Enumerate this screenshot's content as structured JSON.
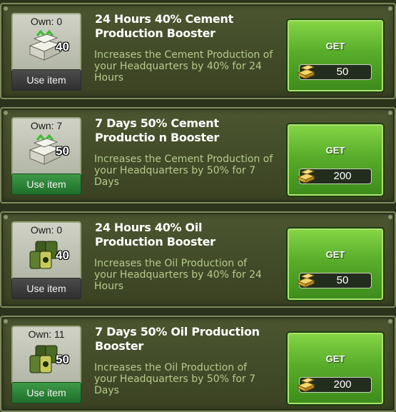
{
  "items": [
    {
      "own": "Own: 0",
      "percent": "40",
      "type": "cement",
      "use_label": "Use item",
      "use_style": "dark",
      "title": "24 Hours 40% Cement Production Booster",
      "description": "Increases the Cement Production of your Headquarters by 40% for 24 Hours",
      "get_label": "GET",
      "price": "50"
    },
    {
      "own": "Own: 7",
      "percent": "50",
      "type": "cement",
      "use_label": "Use item",
      "use_style": "green",
      "title": "7 Days 50% Cement Productio n Booster",
      "description": "Increases the Cement Production of your Headquarters by 50% for 7 Days",
      "get_label": "GET",
      "price": "200"
    },
    {
      "own": "Own: 0",
      "percent": "40",
      "type": "oil",
      "use_label": "Use item",
      "use_style": "dark",
      "title": "24 Hours 40% Oil Production Booster",
      "description": "Increases the Oil Production of your Headquarters by 40% for 24 Hours",
      "get_label": "GET",
      "price": "50"
    },
    {
      "own": "Own: 11",
      "percent": "50",
      "type": "oil",
      "use_label": "Use item",
      "use_style": "green",
      "title": "7 Days 50% Oil Production Booster",
      "description": "Increases the Oil Production of your Headquarters by 50% for 7 Days",
      "get_label": "GET",
      "price": "200"
    }
  ]
}
